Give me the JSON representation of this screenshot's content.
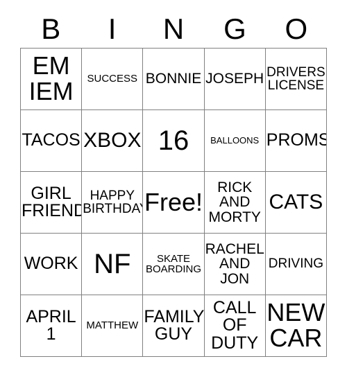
{
  "card": {
    "title": "BINGO",
    "header_letters": [
      "B",
      "I",
      "N",
      "G",
      "O"
    ],
    "rows": [
      [
        {
          "text": "EM\nIEM",
          "size": "sz-xxl"
        },
        {
          "text": "SUCCESS",
          "size": "sz-s"
        },
        {
          "text": "BONNIE",
          "size": "sz-ml"
        },
        {
          "text": "JOSEPH",
          "size": "sz-ml"
        },
        {
          "text": "DRIVERS\nLICENSE",
          "size": "sz-m"
        }
      ],
      [
        {
          "text": "TACOS",
          "size": "sz-l"
        },
        {
          "text": "XBOX",
          "size": "sz-xl"
        },
        {
          "text": "16",
          "size": "sz-huge"
        },
        {
          "text": "BALLOONS",
          "size": "sz-xs"
        },
        {
          "text": "PROMS",
          "size": "sz-l"
        }
      ],
      [
        {
          "text": "GIRL\nFRIEND",
          "size": "sz-l"
        },
        {
          "text": "HAPPY\nBIRTHDAY",
          "size": "sz-m"
        },
        {
          "text": "Free!",
          "size": "sz-xxl"
        },
        {
          "text": "RICK\nAND\nMORTY",
          "size": "sz-ml"
        },
        {
          "text": "CATS",
          "size": "sz-xl"
        }
      ],
      [
        {
          "text": "WORK",
          "size": "sz-l"
        },
        {
          "text": "NF",
          "size": "sz-huge"
        },
        {
          "text": "SKATE\nBOARDING",
          "size": "sz-s"
        },
        {
          "text": "RACHEL\nAND\nJON",
          "size": "sz-ml"
        },
        {
          "text": "DRIVING",
          "size": "sz-m"
        }
      ],
      [
        {
          "text": "APRIL\n1",
          "size": "sz-l"
        },
        {
          "text": "MATTHEW",
          "size": "sz-s"
        },
        {
          "text": "FAMILY\nGUY",
          "size": "sz-l"
        },
        {
          "text": "CALL\nOF\nDUTY",
          "size": "sz-l"
        },
        {
          "text": "NEW\nCAR",
          "size": "sz-xxl"
        }
      ]
    ],
    "free_space": {
      "row": 2,
      "col": 2,
      "label": "Free!"
    },
    "colors": {
      "text": "#000000",
      "grid_line": "#808080",
      "background": "#ffffff"
    }
  }
}
